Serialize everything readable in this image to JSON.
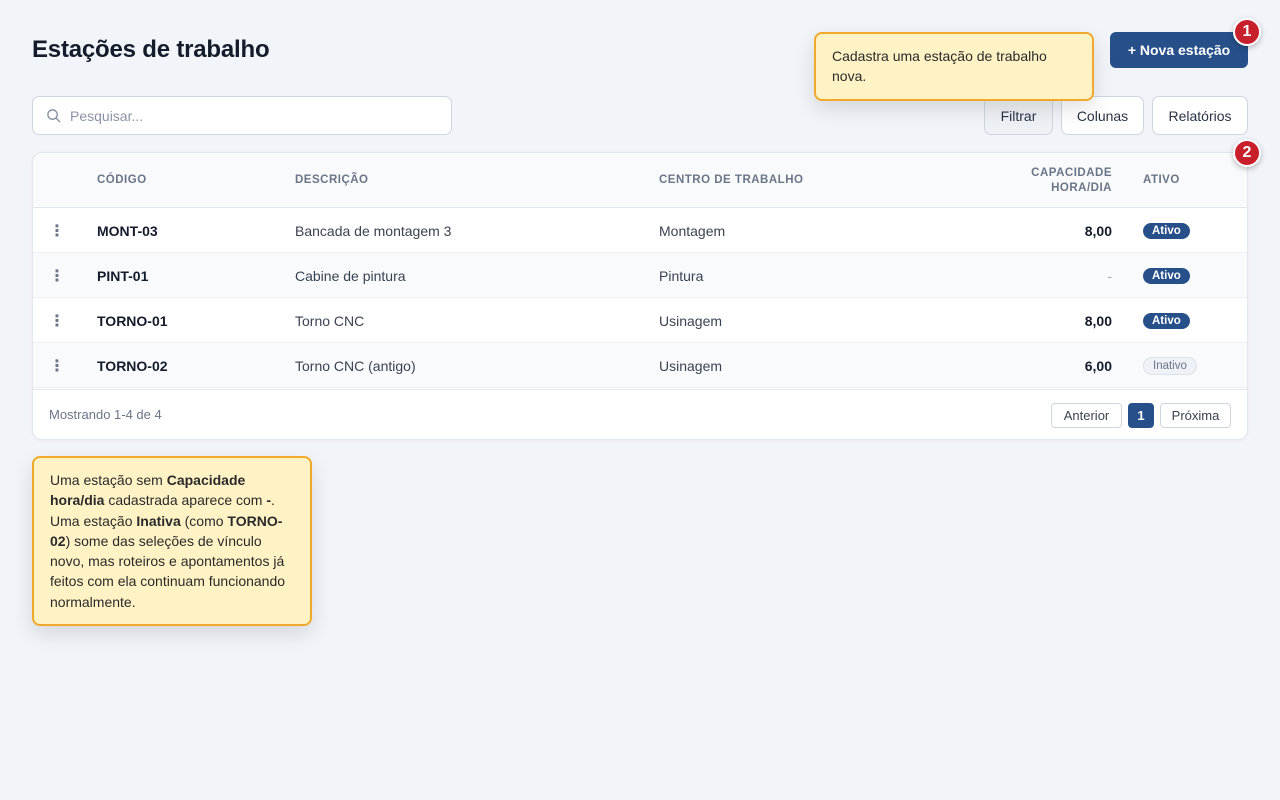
{
  "page": {
    "title": "Estações de trabalho"
  },
  "actions": {
    "new_station": "+ Nova estação"
  },
  "markers": [
    "1",
    "2"
  ],
  "tooltips": {
    "new_station": "Cadastra uma estação de trabalho nova.",
    "table_note": {
      "p1": "Uma estação sem ",
      "b1": "Capacidade hora/dia",
      "p2": " cadastrada aparece com ",
      "b2": "-",
      "p3": ". Uma estação ",
      "b3": "Inativa",
      "p4": " (como ",
      "b4": "TORNO-02",
      "p5": ") some das seleções de vínculo novo, mas roteiros e apontamentos já feitos com ela continuam funcionando normalmente."
    }
  },
  "search": {
    "placeholder": "Pesquisar..."
  },
  "toolbar": {
    "filter": "Filtrar",
    "columns": "Colunas",
    "reports": "Relatórios"
  },
  "table": {
    "columns": {
      "code": "CÓDIGO",
      "description": "DESCRIÇÃO",
      "work_center": "CENTRO DE TRABALHO",
      "capacity_line1": "CAPACIDADE",
      "capacity_line2": "HORA/DIA",
      "active": "ATIVO"
    },
    "row_menu_glyph": "⋮",
    "rows": [
      {
        "code": "MONT-03",
        "description": "Bancada de montagem 3",
        "work_center": "Montagem",
        "capacity": "8,00",
        "status": "Ativo"
      },
      {
        "code": "PINT-01",
        "description": "Cabine de pintura",
        "work_center": "Pintura",
        "capacity": "-",
        "status": "Ativo"
      },
      {
        "code": "TORNO-01",
        "description": "Torno CNC",
        "work_center": "Usinagem",
        "capacity": "8,00",
        "status": "Ativo"
      },
      {
        "code": "TORNO-02",
        "description": "Torno CNC (antigo)",
        "work_center": "Usinagem",
        "capacity": "6,00",
        "status": "Inativo"
      }
    ]
  },
  "pagination": {
    "info": "Mostrando 1-4 de 4",
    "prev": "Anterior",
    "current": "1",
    "next": "Próxima"
  },
  "colors": {
    "primary": "#27508a",
    "marker": "#c8202a",
    "tooltip_bg": "#fff3c6",
    "tooltip_border": "#f0a92c"
  }
}
